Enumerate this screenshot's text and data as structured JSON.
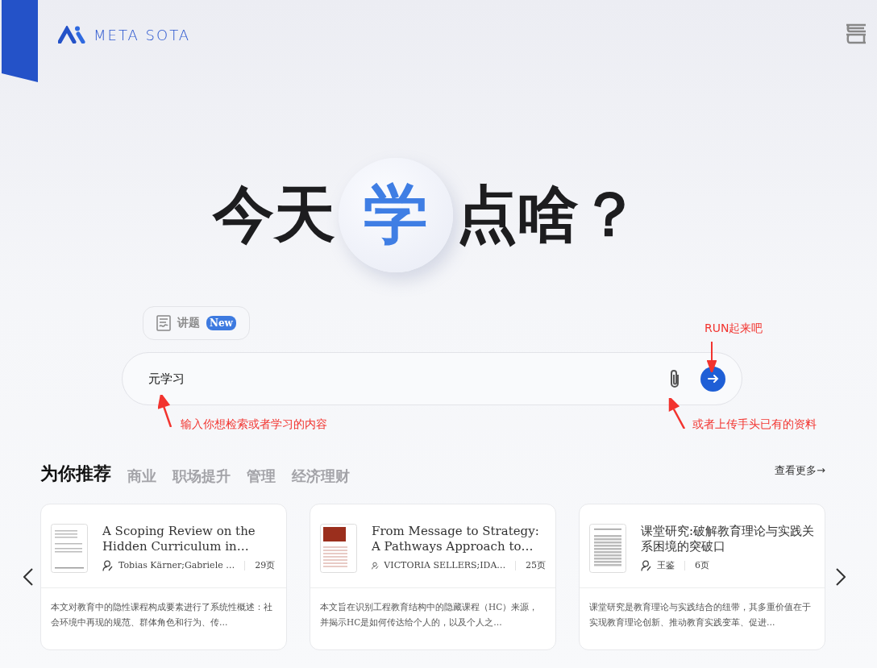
{
  "header": {
    "logo": "META SOTA"
  },
  "hero": {
    "before": "今天",
    "highlight": "学",
    "after": "点啥？"
  },
  "mode_chip": {
    "label": "讲题",
    "badge": "New"
  },
  "search": {
    "value": "元学习"
  },
  "annotations": [
    {
      "text": "RUN起来吧"
    },
    {
      "text": "输入你想检索或者学习的内容"
    },
    {
      "text": "或者上传手头已有的资料"
    }
  ],
  "section": {
    "tabs": [
      {
        "label": "为你推荐",
        "selected": true
      },
      {
        "label": "商业",
        "selected": false
      },
      {
        "label": "职场提升",
        "selected": false
      },
      {
        "label": "管理",
        "selected": false
      },
      {
        "label": "经济理财",
        "selected": false
      }
    ],
    "more": "查看更多→"
  },
  "cards": [
    {
      "kind": "plain",
      "title": "A Scoping Review on the Hidden Curriculum in…",
      "authors": "Tobias Kärner;Gabriele …",
      "pages": "29页",
      "summary": "本文对教育中的隐性课程构成要素进行了系统性概述：社会环境中再现的规范、群体角色和行为、传…"
    },
    {
      "kind": "banner",
      "title": "From Message to Strategy: A Pathways Approach to…",
      "authors": "VICTORIA SELLERS;IDA…",
      "pages": "25页",
      "summary": "本文旨在识别工程教育结构中的隐藏课程（HC）来源，并揭示HC是如何传达给个人的，以及个人之…"
    },
    {
      "kind": "dense",
      "title": "课堂研究:破解教育理论与实践关系困境的突破口",
      "authors": "王鉴",
      "pages": "6页",
      "summary": "课堂研究是教育理论与实践结合的纽带，其多重价值在于实现教育理论创新、推动教育实践变革、促进…"
    }
  ]
}
